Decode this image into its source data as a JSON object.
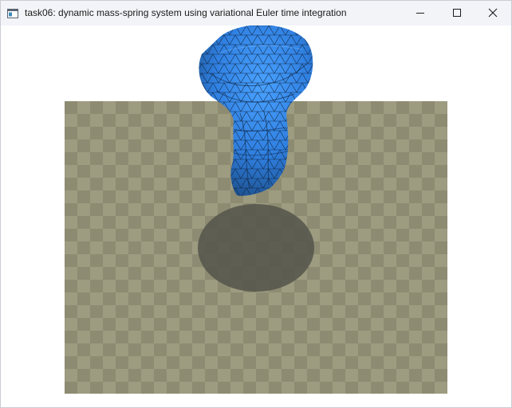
{
  "window": {
    "title": "task06: dynamic mass-spring system using variational Euler time integration",
    "app_icon": "window-app-icon",
    "controls": {
      "minimize_icon": "minimize-icon",
      "maximize_icon": "maximize-icon",
      "close_icon": "close-icon"
    }
  },
  "scene": {
    "floor": {
      "color_light": "#9d9b80",
      "color_dark": "#8d8b71",
      "shadow_color": "#54534a"
    },
    "mesh": {
      "fill_color": "#2f7fe0",
      "wire_color": "#0b1f3a"
    }
  }
}
